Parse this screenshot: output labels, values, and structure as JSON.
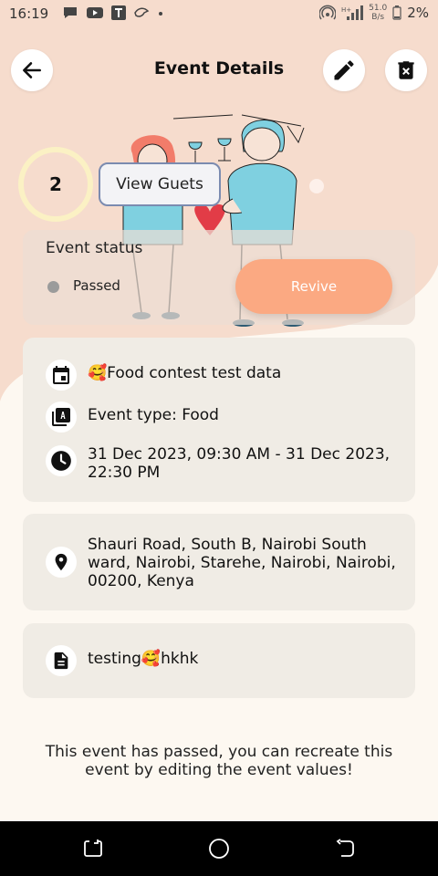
{
  "status_bar": {
    "time": "16:19",
    "net_speed_value": "51.0",
    "net_speed_unit": "B/s",
    "battery": "2%",
    "icons": [
      "message-icon",
      "youtube-icon",
      "t-app-icon",
      "bird-icon",
      "dot-icon",
      "hotspot-icon",
      "signal-icon",
      "battery-icon"
    ]
  },
  "header": {
    "title": "Event Details",
    "back_icon": "arrow-left-icon",
    "edit_icon": "pencil-icon",
    "delete_icon": "trash-icon"
  },
  "guests": {
    "count": "2",
    "button_label": "View Guets"
  },
  "status": {
    "title": "Event status",
    "value": "Passed",
    "dot_color": "#9b9b9b",
    "action_label": "Revive"
  },
  "details": {
    "name": "🥰Food contest test data",
    "type": "Event type: Food",
    "datetime": "31 Dec 2023, 09:30 AM - 31 Dec 2023, 22:30 PM"
  },
  "location": {
    "address": "Shauri Road, South B, Nairobi South ward, Nairobi, Starehe, Nairobi, Nairobi, 00200, Kenya"
  },
  "description": {
    "text": "testing🥰hkhk"
  },
  "footer": {
    "note": "This event has passed, you can recreate this event by editing the event values!"
  },
  "colors": {
    "background": "#fdf8f1",
    "wave": "#f6dccd",
    "accent": "#fba982",
    "card": "#f0ece5",
    "guest_ring": "#fbf1c4"
  }
}
